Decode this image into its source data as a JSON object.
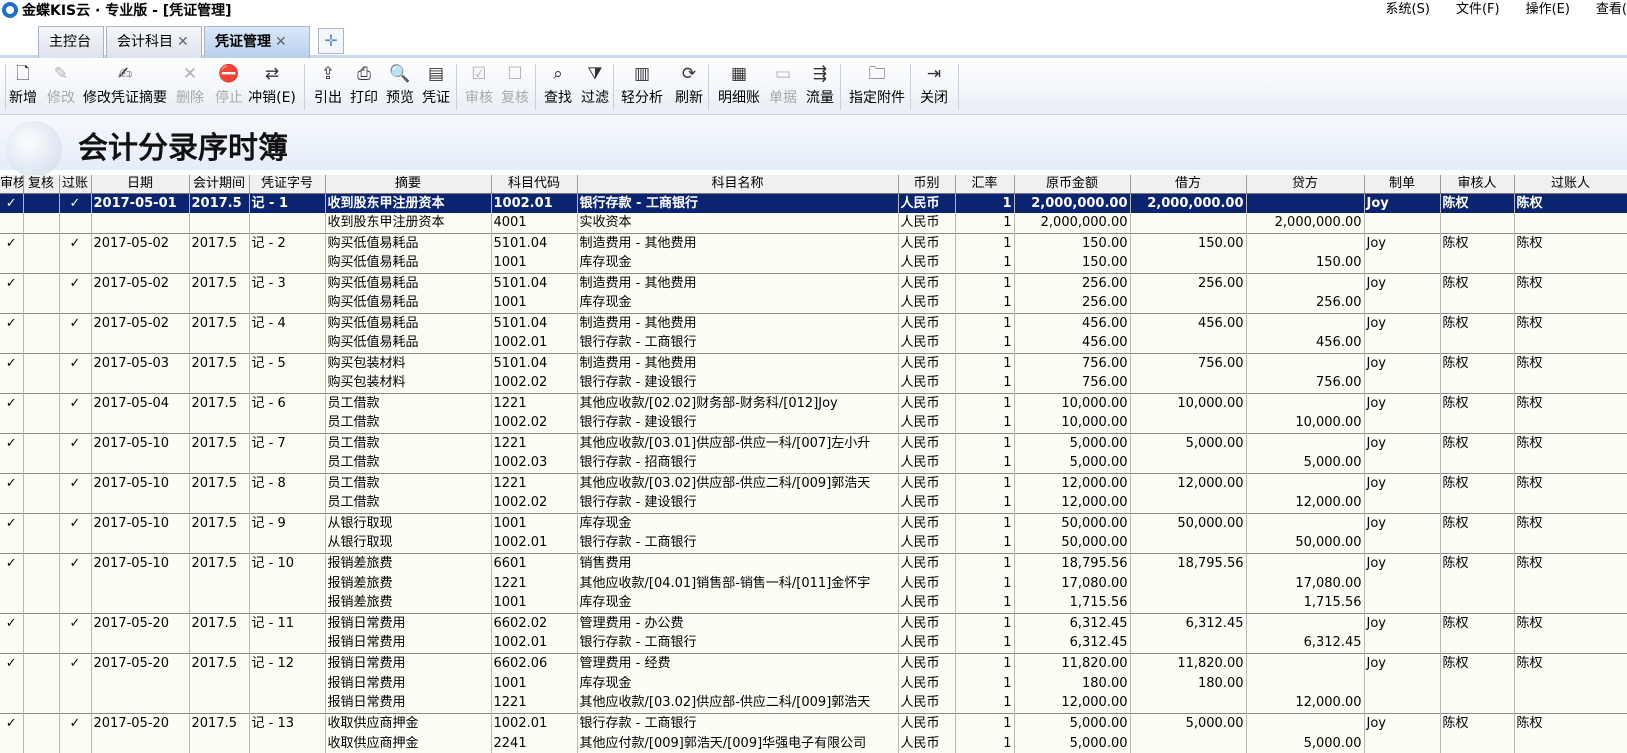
{
  "window": {
    "title": "金蝶KIS云 · 专业版 - [凭证管理]",
    "menu": [
      "系统(S)",
      "文件(F)",
      "操作(E)",
      "查看("
    ]
  },
  "tabs": [
    {
      "label": "主控台",
      "closable": false,
      "active": false
    },
    {
      "label": "会计科目",
      "closable": true,
      "active": false
    },
    {
      "label": "凭证管理",
      "closable": true,
      "active": true
    }
  ],
  "toolbar": [
    {
      "label": "新增",
      "icon": "new-doc-icon",
      "enabled": true
    },
    {
      "label": "修改",
      "icon": "edit-icon",
      "enabled": false
    },
    {
      "label": "修改凭证摘要",
      "icon": "edit-summary-icon",
      "enabled": true
    },
    {
      "label": "删除",
      "icon": "delete-icon",
      "enabled": false
    },
    {
      "label": "停止",
      "icon": "stop-icon",
      "enabled": false
    },
    {
      "label": "冲销(E)",
      "icon": "reverse-icon",
      "enabled": true
    },
    {
      "label": "引出",
      "icon": "export-icon",
      "enabled": true
    },
    {
      "label": "打印",
      "icon": "print-icon",
      "enabled": true
    },
    {
      "label": "预览",
      "icon": "preview-icon",
      "enabled": true
    },
    {
      "label": "凭证",
      "icon": "voucher-icon",
      "enabled": true
    },
    {
      "label": "审核",
      "icon": "audit-icon",
      "enabled": false
    },
    {
      "label": "复核",
      "icon": "recheck-icon",
      "enabled": false
    },
    {
      "label": "查找",
      "icon": "find-icon",
      "enabled": true
    },
    {
      "label": "过滤",
      "icon": "filter-icon",
      "enabled": true
    },
    {
      "label": "轻分析",
      "icon": "analysis-icon",
      "enabled": true
    },
    {
      "label": "刷新",
      "icon": "refresh-icon",
      "enabled": true
    },
    {
      "label": "明细账",
      "icon": "ledger-icon",
      "enabled": true
    },
    {
      "label": "单据",
      "icon": "document-icon",
      "enabled": false
    },
    {
      "label": "流量",
      "icon": "flow-icon",
      "enabled": true
    },
    {
      "label": "指定附件",
      "icon": "folder-icon",
      "enabled": true
    },
    {
      "label": "关闭",
      "icon": "exit-icon",
      "enabled": true
    }
  ],
  "page_title": "会计分录序时簿",
  "columns": [
    "审核",
    "复核",
    "过账",
    "日期",
    "会计期间",
    "凭证字号",
    "摘要",
    "科目代码",
    "科目名称",
    "币别",
    "汇率",
    "原币金额",
    "借方",
    "贷方",
    "制单",
    "审核人",
    "过账人"
  ],
  "rows": [
    {
      "audit": "✓",
      "recheck": "",
      "post": "✓",
      "date": "2017-05-01",
      "period": "2017.5",
      "voucher": "记 - 1",
      "summary": "收到股东甲注册资本",
      "code": "1002.01",
      "account": "银行存款 - 工商银行",
      "currency": "人民币",
      "rate": "1",
      "amount": "2,000,000.00",
      "debit": "2,000,000.00",
      "credit": "",
      "maker": "Joy",
      "auditor": "陈权",
      "poster": "陈权",
      "first": true,
      "selected": true
    },
    {
      "audit": "",
      "recheck": "",
      "post": "",
      "date": "",
      "period": "",
      "voucher": "",
      "summary": "收到股东甲注册资本",
      "code": "4001",
      "account": "实收资本",
      "currency": "人民币",
      "rate": "1",
      "amount": "2,000,000.00",
      "debit": "",
      "credit": "2,000,000.00",
      "maker": "",
      "auditor": "",
      "poster": "",
      "first": false,
      "selected": false
    },
    {
      "audit": "✓",
      "recheck": "",
      "post": "✓",
      "date": "2017-05-02",
      "period": "2017.5",
      "voucher": "记 - 2",
      "summary": "购买低值易耗品",
      "code": "5101.04",
      "account": "制造费用 - 其他费用",
      "currency": "人民币",
      "rate": "1",
      "amount": "150.00",
      "debit": "150.00",
      "credit": "",
      "maker": "Joy",
      "auditor": "陈权",
      "poster": "陈权",
      "first": true,
      "selected": false
    },
    {
      "audit": "",
      "recheck": "",
      "post": "",
      "date": "",
      "period": "",
      "voucher": "",
      "summary": "购买低值易耗品",
      "code": "1001",
      "account": "库存现金",
      "currency": "人民币",
      "rate": "1",
      "amount": "150.00",
      "debit": "",
      "credit": "150.00",
      "maker": "",
      "auditor": "",
      "poster": "",
      "first": false,
      "selected": false
    },
    {
      "audit": "✓",
      "recheck": "",
      "post": "✓",
      "date": "2017-05-02",
      "period": "2017.5",
      "voucher": "记 - 3",
      "summary": "购买低值易耗品",
      "code": "5101.04",
      "account": "制造费用 - 其他费用",
      "currency": "人民币",
      "rate": "1",
      "amount": "256.00",
      "debit": "256.00",
      "credit": "",
      "maker": "Joy",
      "auditor": "陈权",
      "poster": "陈权",
      "first": true,
      "selected": false
    },
    {
      "audit": "",
      "recheck": "",
      "post": "",
      "date": "",
      "period": "",
      "voucher": "",
      "summary": "购买低值易耗品",
      "code": "1001",
      "account": "库存现金",
      "currency": "人民币",
      "rate": "1",
      "amount": "256.00",
      "debit": "",
      "credit": "256.00",
      "maker": "",
      "auditor": "",
      "poster": "",
      "first": false,
      "selected": false
    },
    {
      "audit": "✓",
      "recheck": "",
      "post": "✓",
      "date": "2017-05-02",
      "period": "2017.5",
      "voucher": "记 - 4",
      "summary": "购买低值易耗品",
      "code": "5101.04",
      "account": "制造费用 - 其他费用",
      "currency": "人民币",
      "rate": "1",
      "amount": "456.00",
      "debit": "456.00",
      "credit": "",
      "maker": "Joy",
      "auditor": "陈权",
      "poster": "陈权",
      "first": true,
      "selected": false
    },
    {
      "audit": "",
      "recheck": "",
      "post": "",
      "date": "",
      "period": "",
      "voucher": "",
      "summary": "购买低值易耗品",
      "code": "1002.01",
      "account": "银行存款 - 工商银行",
      "currency": "人民币",
      "rate": "1",
      "amount": "456.00",
      "debit": "",
      "credit": "456.00",
      "maker": "",
      "auditor": "",
      "poster": "",
      "first": false,
      "selected": false
    },
    {
      "audit": "✓",
      "recheck": "",
      "post": "✓",
      "date": "2017-05-03",
      "period": "2017.5",
      "voucher": "记 - 5",
      "summary": "购买包装材料",
      "code": "5101.04",
      "account": "制造费用 - 其他费用",
      "currency": "人民币",
      "rate": "1",
      "amount": "756.00",
      "debit": "756.00",
      "credit": "",
      "maker": "Joy",
      "auditor": "陈权",
      "poster": "陈权",
      "first": true,
      "selected": false
    },
    {
      "audit": "",
      "recheck": "",
      "post": "",
      "date": "",
      "period": "",
      "voucher": "",
      "summary": "购买包装材料",
      "code": "1002.02",
      "account": "银行存款 - 建设银行",
      "currency": "人民币",
      "rate": "1",
      "amount": "756.00",
      "debit": "",
      "credit": "756.00",
      "maker": "",
      "auditor": "",
      "poster": "",
      "first": false,
      "selected": false
    },
    {
      "audit": "✓",
      "recheck": "",
      "post": "✓",
      "date": "2017-05-04",
      "period": "2017.5",
      "voucher": "记 - 6",
      "summary": "员工借款",
      "code": "1221",
      "account": "其他应收款/[02.02]财务部-财务科/[012]Joy",
      "currency": "人民币",
      "rate": "1",
      "amount": "10,000.00",
      "debit": "10,000.00",
      "credit": "",
      "maker": "Joy",
      "auditor": "陈权",
      "poster": "陈权",
      "first": true,
      "selected": false
    },
    {
      "audit": "",
      "recheck": "",
      "post": "",
      "date": "",
      "period": "",
      "voucher": "",
      "summary": "员工借款",
      "code": "1002.02",
      "account": "银行存款 - 建设银行",
      "currency": "人民币",
      "rate": "1",
      "amount": "10,000.00",
      "debit": "",
      "credit": "10,000.00",
      "maker": "",
      "auditor": "",
      "poster": "",
      "first": false,
      "selected": false
    },
    {
      "audit": "✓",
      "recheck": "",
      "post": "✓",
      "date": "2017-05-10",
      "period": "2017.5",
      "voucher": "记 - 7",
      "summary": "员工借款",
      "code": "1221",
      "account": "其他应收款/[03.01]供应部-供应一科/[007]左小升",
      "currency": "人民币",
      "rate": "1",
      "amount": "5,000.00",
      "debit": "5,000.00",
      "credit": "",
      "maker": "Joy",
      "auditor": "陈权",
      "poster": "陈权",
      "first": true,
      "selected": false
    },
    {
      "audit": "",
      "recheck": "",
      "post": "",
      "date": "",
      "period": "",
      "voucher": "",
      "summary": "员工借款",
      "code": "1002.03",
      "account": "银行存款 - 招商银行",
      "currency": "人民币",
      "rate": "1",
      "amount": "5,000.00",
      "debit": "",
      "credit": "5,000.00",
      "maker": "",
      "auditor": "",
      "poster": "",
      "first": false,
      "selected": false
    },
    {
      "audit": "✓",
      "recheck": "",
      "post": "✓",
      "date": "2017-05-10",
      "period": "2017.5",
      "voucher": "记 - 8",
      "summary": "员工借款",
      "code": "1221",
      "account": "其他应收款/[03.02]供应部-供应二科/[009]郭浩天",
      "currency": "人民币",
      "rate": "1",
      "amount": "12,000.00",
      "debit": "12,000.00",
      "credit": "",
      "maker": "Joy",
      "auditor": "陈权",
      "poster": "陈权",
      "first": true,
      "selected": false
    },
    {
      "audit": "",
      "recheck": "",
      "post": "",
      "date": "",
      "period": "",
      "voucher": "",
      "summary": "员工借款",
      "code": "1002.02",
      "account": "银行存款 - 建设银行",
      "currency": "人民币",
      "rate": "1",
      "amount": "12,000.00",
      "debit": "",
      "credit": "12,000.00",
      "maker": "",
      "auditor": "",
      "poster": "",
      "first": false,
      "selected": false
    },
    {
      "audit": "✓",
      "recheck": "",
      "post": "✓",
      "date": "2017-05-10",
      "period": "2017.5",
      "voucher": "记 - 9",
      "summary": "从银行取现",
      "code": "1001",
      "account": "库存现金",
      "currency": "人民币",
      "rate": "1",
      "amount": "50,000.00",
      "debit": "50,000.00",
      "credit": "",
      "maker": "Joy",
      "auditor": "陈权",
      "poster": "陈权",
      "first": true,
      "selected": false
    },
    {
      "audit": "",
      "recheck": "",
      "post": "",
      "date": "",
      "period": "",
      "voucher": "",
      "summary": "从银行取现",
      "code": "1002.01",
      "account": "银行存款 - 工商银行",
      "currency": "人民币",
      "rate": "1",
      "amount": "50,000.00",
      "debit": "",
      "credit": "50,000.00",
      "maker": "",
      "auditor": "",
      "poster": "",
      "first": false,
      "selected": false
    },
    {
      "audit": "✓",
      "recheck": "",
      "post": "✓",
      "date": "2017-05-10",
      "period": "2017.5",
      "voucher": "记 - 10",
      "summary": "报销差旅费",
      "code": "6601",
      "account": "销售费用",
      "currency": "人民币",
      "rate": "1",
      "amount": "18,795.56",
      "debit": "18,795.56",
      "credit": "",
      "maker": "Joy",
      "auditor": "陈权",
      "poster": "陈权",
      "first": true,
      "selected": false
    },
    {
      "audit": "",
      "recheck": "",
      "post": "",
      "date": "",
      "period": "",
      "voucher": "",
      "summary": "报销差旅费",
      "code": "1221",
      "account": "其他应收款/[04.01]销售部-销售一科/[011]金怀宇",
      "currency": "人民币",
      "rate": "1",
      "amount": "17,080.00",
      "debit": "",
      "credit": "17,080.00",
      "maker": "",
      "auditor": "",
      "poster": "",
      "first": false,
      "selected": false
    },
    {
      "audit": "",
      "recheck": "",
      "post": "",
      "date": "",
      "period": "",
      "voucher": "",
      "summary": "报销差旅费",
      "code": "1001",
      "account": "库存现金",
      "currency": "人民币",
      "rate": "1",
      "amount": "1,715.56",
      "debit": "",
      "credit": "1,715.56",
      "maker": "",
      "auditor": "",
      "poster": "",
      "first": false,
      "selected": false
    },
    {
      "audit": "✓",
      "recheck": "",
      "post": "✓",
      "date": "2017-05-20",
      "period": "2017.5",
      "voucher": "记 - 11",
      "summary": "报销日常费用",
      "code": "6602.02",
      "account": "管理费用 - 办公费",
      "currency": "人民币",
      "rate": "1",
      "amount": "6,312.45",
      "debit": "6,312.45",
      "credit": "",
      "maker": "Joy",
      "auditor": "陈权",
      "poster": "陈权",
      "first": true,
      "selected": false
    },
    {
      "audit": "",
      "recheck": "",
      "post": "",
      "date": "",
      "period": "",
      "voucher": "",
      "summary": "报销日常费用",
      "code": "1002.01",
      "account": "银行存款 - 工商银行",
      "currency": "人民币",
      "rate": "1",
      "amount": "6,312.45",
      "debit": "",
      "credit": "6,312.45",
      "maker": "",
      "auditor": "",
      "poster": "",
      "first": false,
      "selected": false
    },
    {
      "audit": "✓",
      "recheck": "",
      "post": "✓",
      "date": "2017-05-20",
      "period": "2017.5",
      "voucher": "记 - 12",
      "summary": "报销日常费用",
      "code": "6602.06",
      "account": "管理费用 - 经费",
      "currency": "人民币",
      "rate": "1",
      "amount": "11,820.00",
      "debit": "11,820.00",
      "credit": "",
      "maker": "Joy",
      "auditor": "陈权",
      "poster": "陈权",
      "first": true,
      "selected": false
    },
    {
      "audit": "",
      "recheck": "",
      "post": "",
      "date": "",
      "period": "",
      "voucher": "",
      "summary": "报销日常费用",
      "code": "1001",
      "account": "库存现金",
      "currency": "人民币",
      "rate": "1",
      "amount": "180.00",
      "debit": "180.00",
      "credit": "",
      "maker": "",
      "auditor": "",
      "poster": "",
      "first": false,
      "selected": false
    },
    {
      "audit": "",
      "recheck": "",
      "post": "",
      "date": "",
      "period": "",
      "voucher": "",
      "summary": "报销日常费用",
      "code": "1221",
      "account": "其他应收款/[03.02]供应部-供应二科/[009]郭浩天",
      "currency": "人民币",
      "rate": "1",
      "amount": "12,000.00",
      "debit": "",
      "credit": "12,000.00",
      "maker": "",
      "auditor": "",
      "poster": "",
      "first": false,
      "selected": false
    },
    {
      "audit": "✓",
      "recheck": "",
      "post": "✓",
      "date": "2017-05-20",
      "period": "2017.5",
      "voucher": "记 - 13",
      "summary": "收取供应商押金",
      "code": "1002.01",
      "account": "银行存款 - 工商银行",
      "currency": "人民币",
      "rate": "1",
      "amount": "5,000.00",
      "debit": "5,000.00",
      "credit": "",
      "maker": "Joy",
      "auditor": "陈权",
      "poster": "陈权",
      "first": true,
      "selected": false
    },
    {
      "audit": "",
      "recheck": "",
      "post": "",
      "date": "",
      "period": "",
      "voucher": "",
      "summary": "收取供应商押金",
      "code": "2241",
      "account": "其他应付款/[009]郭浩天/[009]华强电子有限公司",
      "currency": "人民币",
      "rate": "1",
      "amount": "5,000.00",
      "debit": "",
      "credit": "5,000.00",
      "maker": "",
      "auditor": "",
      "poster": "",
      "first": false,
      "selected": false
    }
  ]
}
